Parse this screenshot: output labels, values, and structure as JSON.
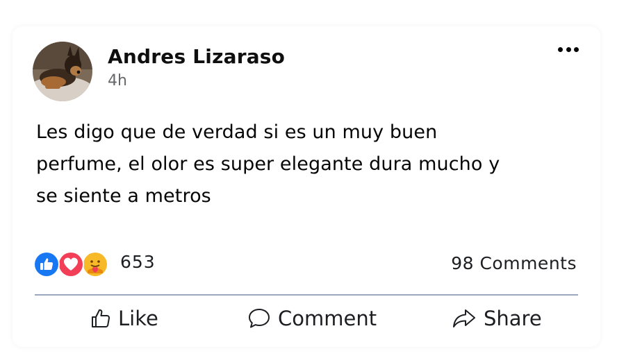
{
  "post": {
    "author": "Andres Lizaraso",
    "time": "4h",
    "text": "Les digo que de verdad si es un muy buen\nperfume, el olor es super elegante dura mucho y\nse siente a metros",
    "reactions": {
      "icons": [
        "like-icon",
        "love-icon",
        "care-icon"
      ],
      "count": "653"
    },
    "comments": "98 Comments"
  },
  "actions": {
    "like": "Like",
    "comment": "Comment",
    "share": "Share"
  },
  "colors": {
    "like_blue": "#1877f2",
    "love_red": "#f33e58",
    "care_yellow": "#f7b928",
    "divider": "#9aa7bd",
    "secondary_text": "#65676b"
  }
}
